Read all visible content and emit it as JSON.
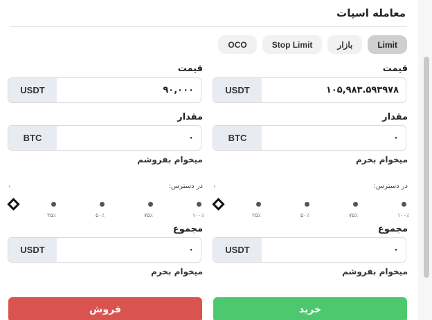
{
  "panel": {
    "title": "معامله اسپات"
  },
  "tabs": [
    {
      "label": "Limit",
      "active": true
    },
    {
      "label": "بازار",
      "active": false
    },
    {
      "label": "Stop Limit",
      "active": false
    },
    {
      "label": "OCO",
      "active": false
    }
  ],
  "buy": {
    "price_label": "قیمت",
    "price_value": "۱۰۵,۹۸۳.۵۹۳۹۷۸",
    "price_unit": "USDT",
    "amount_label": "مقدار",
    "amount_value": "۰",
    "amount_unit": "BTC",
    "amount_hint": "میخوام بخرم",
    "available_label": "در دسترس:",
    "available_value": "۰",
    "slider_ticks": [
      "۱۰۰٪",
      "۷۵٪",
      "۵۰٪",
      "۲۵٪"
    ],
    "total_label": "مجموع",
    "total_value": "۰",
    "total_unit": "USDT",
    "total_hint": "میخوام بفروشم",
    "submit_label": "خرید"
  },
  "sell": {
    "price_label": "قیمت",
    "price_value": "۹۰,۰۰۰",
    "price_unit": "USDT",
    "amount_label": "مقدار",
    "amount_value": "۰",
    "amount_unit": "BTC",
    "amount_hint": "میخوام بفروشم",
    "available_label": "در دسترس:",
    "available_value": "۰",
    "slider_ticks": [
      "۱۰۰٪",
      "۷۵٪",
      "۵۰٪",
      "۲۵٪"
    ],
    "total_label": "مجموع",
    "total_value": "۰",
    "total_unit": "USDT",
    "total_hint": "میخوام بخرم",
    "submit_label": "فروش"
  },
  "colors": {
    "buy_button": "#4ec86f",
    "sell_button": "#d9534f",
    "unit_bg": "#e8ecf2"
  }
}
